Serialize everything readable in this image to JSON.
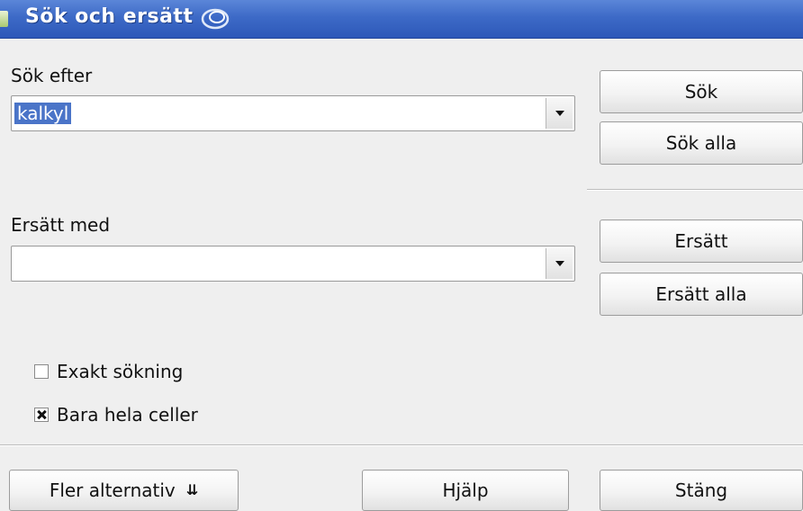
{
  "window": {
    "title": "Sök och ersätt"
  },
  "search": {
    "label": "Sök efter",
    "value": "kalkyl"
  },
  "replace": {
    "label": "Ersätt med",
    "value": ""
  },
  "buttons": {
    "find": "Sök",
    "find_all": "Sök alla",
    "replace": "Ersätt",
    "replace_all": "Ersätt alla",
    "more_options": "Fler alternativ",
    "help": "Hjälp",
    "close": "Stäng"
  },
  "options": [
    {
      "label": "Exakt sökning",
      "checked": false
    },
    {
      "label": "Bara hela celler",
      "checked": true
    }
  ],
  "icons": {
    "title_decoration": "swirl-icon",
    "dropdown": "chevron-down-icon",
    "more_options": "double-chevron-down-icon"
  },
  "colors": {
    "titlebar": "#3d6ac7",
    "selection": "#4a74c8"
  }
}
